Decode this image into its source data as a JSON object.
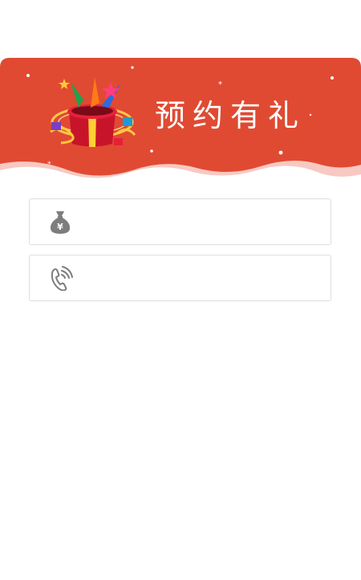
{
  "banner": {
    "title": "预约有礼",
    "background_color": "#e04a32",
    "wave_color": "#f7c9c2"
  },
  "form": {
    "amount_field": {
      "icon": "money-bag-yuan-icon",
      "value": "",
      "placeholder": ""
    },
    "phone_field": {
      "icon": "phone-call-icon",
      "value": "",
      "placeholder": ""
    }
  }
}
